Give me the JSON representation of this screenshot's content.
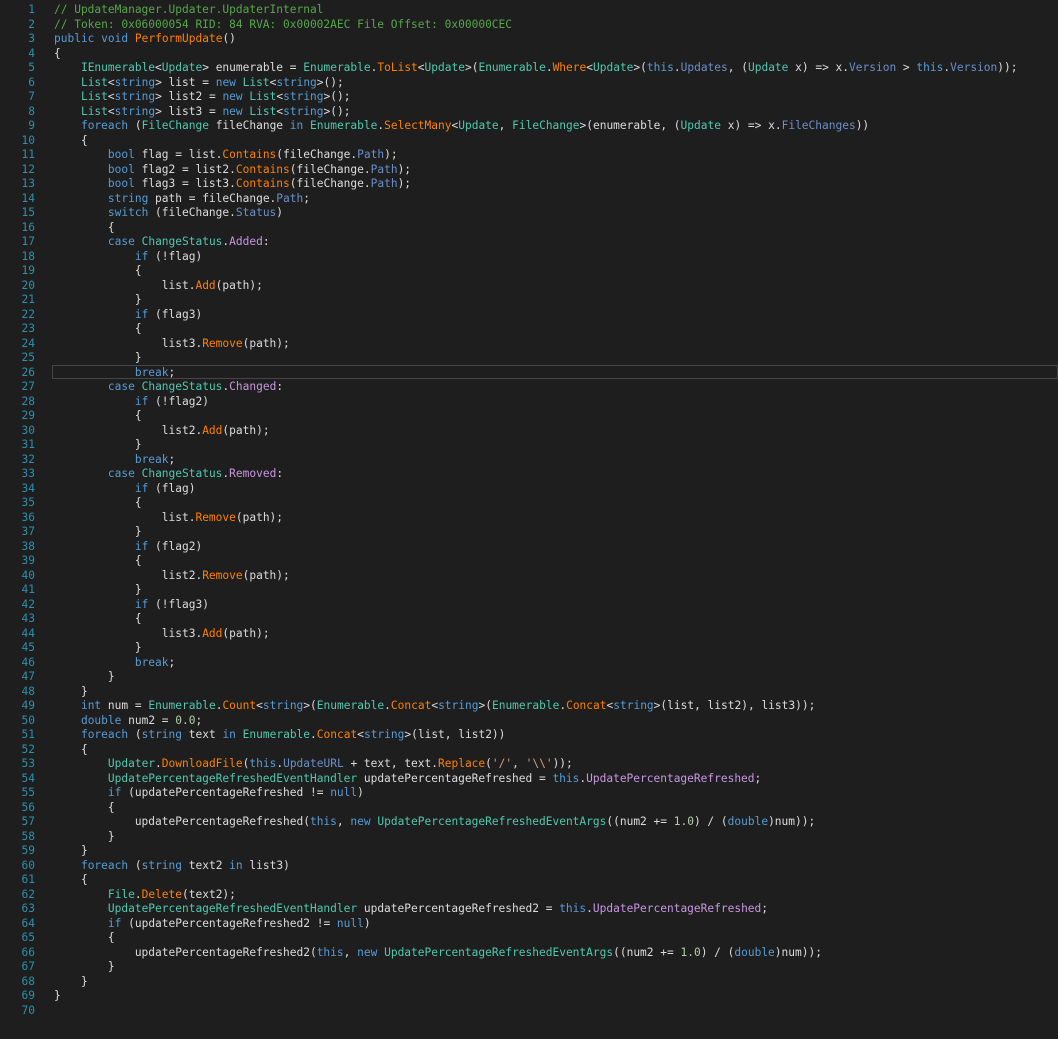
{
  "editor": {
    "lines": [
      [
        [
          "c",
          "// UpdateManager.Updater.UpdaterInternal"
        ]
      ],
      [
        [
          "c",
          "// Token: 0x06000054 RID: 84 RVA: 0x00002AEC File Offset: 0x00000CEC"
        ]
      ],
      [
        [
          "k",
          "public"
        ],
        [
          "p",
          " "
        ],
        [
          "k",
          "void"
        ],
        [
          "p",
          " "
        ],
        [
          "m",
          "PerformUpdate"
        ],
        [
          "p",
          "()"
        ]
      ],
      [
        [
          "p",
          "{"
        ]
      ],
      [
        [
          "p",
          "    "
        ],
        [
          "ty",
          "IEnumerable"
        ],
        [
          "p",
          "<"
        ],
        [
          "ty",
          "Update"
        ],
        [
          "p",
          "> enumerable = "
        ],
        [
          "ty",
          "Enumerable"
        ],
        [
          "p",
          "."
        ],
        [
          "m",
          "ToList"
        ],
        [
          "p",
          "<"
        ],
        [
          "ty",
          "Update"
        ],
        [
          "p",
          ">("
        ],
        [
          "ty",
          "Enumerable"
        ],
        [
          "p",
          "."
        ],
        [
          "m",
          "Where"
        ],
        [
          "p",
          "<"
        ],
        [
          "ty",
          "Update"
        ],
        [
          "p",
          ">("
        ],
        [
          "k",
          "this"
        ],
        [
          "p",
          "."
        ],
        [
          "pr",
          "Updates"
        ],
        [
          "p",
          ", ("
        ],
        [
          "ty",
          "Update"
        ],
        [
          "p",
          " x) => x."
        ],
        [
          "pr",
          "Version"
        ],
        [
          "p",
          " > "
        ],
        [
          "k",
          "this"
        ],
        [
          "p",
          "."
        ],
        [
          "pr",
          "Version"
        ],
        [
          "p",
          "));"
        ]
      ],
      [
        [
          "p",
          "    "
        ],
        [
          "ty",
          "List"
        ],
        [
          "p",
          "<"
        ],
        [
          "k",
          "string"
        ],
        [
          "p",
          "> list = "
        ],
        [
          "k",
          "new"
        ],
        [
          "p",
          " "
        ],
        [
          "ty",
          "List"
        ],
        [
          "p",
          "<"
        ],
        [
          "k",
          "string"
        ],
        [
          "p",
          ">();"
        ]
      ],
      [
        [
          "p",
          "    "
        ],
        [
          "ty",
          "List"
        ],
        [
          "p",
          "<"
        ],
        [
          "k",
          "string"
        ],
        [
          "p",
          "> list2 = "
        ],
        [
          "k",
          "new"
        ],
        [
          "p",
          " "
        ],
        [
          "ty",
          "List"
        ],
        [
          "p",
          "<"
        ],
        [
          "k",
          "string"
        ],
        [
          "p",
          ">();"
        ]
      ],
      [
        [
          "p",
          "    "
        ],
        [
          "ty",
          "List"
        ],
        [
          "p",
          "<"
        ],
        [
          "k",
          "string"
        ],
        [
          "p",
          "> list3 = "
        ],
        [
          "k",
          "new"
        ],
        [
          "p",
          " "
        ],
        [
          "ty",
          "List"
        ],
        [
          "p",
          "<"
        ],
        [
          "k",
          "string"
        ],
        [
          "p",
          ">();"
        ]
      ],
      [
        [
          "p",
          "    "
        ],
        [
          "k",
          "foreach"
        ],
        [
          "p",
          " ("
        ],
        [
          "ty",
          "FileChange"
        ],
        [
          "p",
          " fileChange "
        ],
        [
          "k",
          "in"
        ],
        [
          "p",
          " "
        ],
        [
          "ty",
          "Enumerable"
        ],
        [
          "p",
          "."
        ],
        [
          "m",
          "SelectMany"
        ],
        [
          "p",
          "<"
        ],
        [
          "ty",
          "Update"
        ],
        [
          "p",
          ", "
        ],
        [
          "ty",
          "FileChange"
        ],
        [
          "p",
          ">(enumerable, ("
        ],
        [
          "ty",
          "Update"
        ],
        [
          "p",
          " x) => x."
        ],
        [
          "pr",
          "FileChanges"
        ],
        [
          "p",
          "))"
        ]
      ],
      [
        [
          "p",
          "    {"
        ]
      ],
      [
        [
          "p",
          "        "
        ],
        [
          "k",
          "bool"
        ],
        [
          "p",
          " flag = list."
        ],
        [
          "m",
          "Contains"
        ],
        [
          "p",
          "(fileChange."
        ],
        [
          "pr",
          "Path"
        ],
        [
          "p",
          ");"
        ]
      ],
      [
        [
          "p",
          "        "
        ],
        [
          "k",
          "bool"
        ],
        [
          "p",
          " flag2 = list2."
        ],
        [
          "m",
          "Contains"
        ],
        [
          "p",
          "(fileChange."
        ],
        [
          "pr",
          "Path"
        ],
        [
          "p",
          ");"
        ]
      ],
      [
        [
          "p",
          "        "
        ],
        [
          "k",
          "bool"
        ],
        [
          "p",
          " flag3 = list3."
        ],
        [
          "m",
          "Contains"
        ],
        [
          "p",
          "(fileChange."
        ],
        [
          "pr",
          "Path"
        ],
        [
          "p",
          ");"
        ]
      ],
      [
        [
          "p",
          "        "
        ],
        [
          "k",
          "string"
        ],
        [
          "p",
          " path = fileChange."
        ],
        [
          "pr",
          "Path"
        ],
        [
          "p",
          ";"
        ]
      ],
      [
        [
          "p",
          "        "
        ],
        [
          "k",
          "switch"
        ],
        [
          "p",
          " (fileChange."
        ],
        [
          "pr",
          "Status"
        ],
        [
          "p",
          ")"
        ]
      ],
      [
        [
          "p",
          "        {"
        ]
      ],
      [
        [
          "p",
          "        "
        ],
        [
          "k",
          "case"
        ],
        [
          "p",
          " "
        ],
        [
          "ty",
          "ChangeStatus"
        ],
        [
          "p",
          "."
        ],
        [
          "e",
          "Added"
        ],
        [
          "p",
          ":"
        ]
      ],
      [
        [
          "p",
          "            "
        ],
        [
          "k",
          "if"
        ],
        [
          "p",
          " (!flag)"
        ]
      ],
      [
        [
          "p",
          "            {"
        ]
      ],
      [
        [
          "p",
          "                list."
        ],
        [
          "m",
          "Add"
        ],
        [
          "p",
          "(path);"
        ]
      ],
      [
        [
          "p",
          "            }"
        ]
      ],
      [
        [
          "p",
          "            "
        ],
        [
          "k",
          "if"
        ],
        [
          "p",
          " (flag3)"
        ]
      ],
      [
        [
          "p",
          "            {"
        ]
      ],
      [
        [
          "p",
          "                list3."
        ],
        [
          "m",
          "Remove"
        ],
        [
          "p",
          "(path);"
        ]
      ],
      [
        [
          "p",
          "            }"
        ]
      ],
      [
        [
          "p",
          "            "
        ],
        [
          "k",
          "break"
        ],
        [
          "p",
          ";"
        ]
      ],
      [
        [
          "p",
          "        "
        ],
        [
          "k",
          "case"
        ],
        [
          "p",
          " "
        ],
        [
          "ty",
          "ChangeStatus"
        ],
        [
          "p",
          "."
        ],
        [
          "e",
          "Changed"
        ],
        [
          "p",
          ":"
        ]
      ],
      [
        [
          "p",
          "            "
        ],
        [
          "k",
          "if"
        ],
        [
          "p",
          " (!flag2)"
        ]
      ],
      [
        [
          "p",
          "            {"
        ]
      ],
      [
        [
          "p",
          "                list2."
        ],
        [
          "m",
          "Add"
        ],
        [
          "p",
          "(path);"
        ]
      ],
      [
        [
          "p",
          "            }"
        ]
      ],
      [
        [
          "p",
          "            "
        ],
        [
          "k",
          "break"
        ],
        [
          "p",
          ";"
        ]
      ],
      [
        [
          "p",
          "        "
        ],
        [
          "k",
          "case"
        ],
        [
          "p",
          " "
        ],
        [
          "ty",
          "ChangeStatus"
        ],
        [
          "p",
          "."
        ],
        [
          "e",
          "Removed"
        ],
        [
          "p",
          ":"
        ]
      ],
      [
        [
          "p",
          "            "
        ],
        [
          "k",
          "if"
        ],
        [
          "p",
          " (flag)"
        ]
      ],
      [
        [
          "p",
          "            {"
        ]
      ],
      [
        [
          "p",
          "                list."
        ],
        [
          "m",
          "Remove"
        ],
        [
          "p",
          "(path);"
        ]
      ],
      [
        [
          "p",
          "            }"
        ]
      ],
      [
        [
          "p",
          "            "
        ],
        [
          "k",
          "if"
        ],
        [
          "p",
          " (flag2)"
        ]
      ],
      [
        [
          "p",
          "            {"
        ]
      ],
      [
        [
          "p",
          "                list2."
        ],
        [
          "m",
          "Remove"
        ],
        [
          "p",
          "(path);"
        ]
      ],
      [
        [
          "p",
          "            }"
        ]
      ],
      [
        [
          "p",
          "            "
        ],
        [
          "k",
          "if"
        ],
        [
          "p",
          " (!flag3)"
        ]
      ],
      [
        [
          "p",
          "            {"
        ]
      ],
      [
        [
          "p",
          "                list3."
        ],
        [
          "m",
          "Add"
        ],
        [
          "p",
          "(path);"
        ]
      ],
      [
        [
          "p",
          "            }"
        ]
      ],
      [
        [
          "p",
          "            "
        ],
        [
          "k",
          "break"
        ],
        [
          "p",
          ";"
        ]
      ],
      [
        [
          "p",
          "        }"
        ]
      ],
      [
        [
          "p",
          "    }"
        ]
      ],
      [
        [
          "p",
          "    "
        ],
        [
          "k",
          "int"
        ],
        [
          "p",
          " num = "
        ],
        [
          "ty",
          "Enumerable"
        ],
        [
          "p",
          "."
        ],
        [
          "m",
          "Count"
        ],
        [
          "p",
          "<"
        ],
        [
          "k",
          "string"
        ],
        [
          "p",
          ">("
        ],
        [
          "ty",
          "Enumerable"
        ],
        [
          "p",
          "."
        ],
        [
          "m",
          "Concat"
        ],
        [
          "p",
          "<"
        ],
        [
          "k",
          "string"
        ],
        [
          "p",
          ">("
        ],
        [
          "ty",
          "Enumerable"
        ],
        [
          "p",
          "."
        ],
        [
          "m",
          "Concat"
        ],
        [
          "p",
          "<"
        ],
        [
          "k",
          "string"
        ],
        [
          "p",
          ">(list, list2), list3));"
        ]
      ],
      [
        [
          "p",
          "    "
        ],
        [
          "k",
          "double"
        ],
        [
          "p",
          " num2 = "
        ],
        [
          "n",
          "0.0"
        ],
        [
          "p",
          ";"
        ]
      ],
      [
        [
          "p",
          "    "
        ],
        [
          "k",
          "foreach"
        ],
        [
          "p",
          " ("
        ],
        [
          "k",
          "string"
        ],
        [
          "p",
          " text "
        ],
        [
          "k",
          "in"
        ],
        [
          "p",
          " "
        ],
        [
          "ty",
          "Enumerable"
        ],
        [
          "p",
          "."
        ],
        [
          "m",
          "Concat"
        ],
        [
          "p",
          "<"
        ],
        [
          "k",
          "string"
        ],
        [
          "p",
          ">(list, list2))"
        ]
      ],
      [
        [
          "p",
          "    {"
        ]
      ],
      [
        [
          "p",
          "        "
        ],
        [
          "ty",
          "Updater"
        ],
        [
          "p",
          "."
        ],
        [
          "m",
          "DownloadFile"
        ],
        [
          "p",
          "("
        ],
        [
          "k",
          "this"
        ],
        [
          "p",
          "."
        ],
        [
          "pr",
          "UpdateURL"
        ],
        [
          "p",
          " + text, text."
        ],
        [
          "m",
          "Replace"
        ],
        [
          "p",
          "("
        ],
        [
          "s",
          "'/'"
        ],
        [
          "p",
          ", "
        ],
        [
          "s",
          "'\\\\'"
        ],
        [
          "p",
          "));"
        ]
      ],
      [
        [
          "p",
          "        "
        ],
        [
          "ty",
          "UpdatePercentageRefreshedEventHandler"
        ],
        [
          "p",
          " updatePercentageRefreshed = "
        ],
        [
          "k",
          "this"
        ],
        [
          "p",
          "."
        ],
        [
          "pp",
          "UpdatePercentageRefreshed"
        ],
        [
          "p",
          ";"
        ]
      ],
      [
        [
          "p",
          "        "
        ],
        [
          "k",
          "if"
        ],
        [
          "p",
          " (updatePercentageRefreshed != "
        ],
        [
          "k",
          "null"
        ],
        [
          "p",
          ")"
        ]
      ],
      [
        [
          "p",
          "        {"
        ]
      ],
      [
        [
          "p",
          "            updatePercentageRefreshed("
        ],
        [
          "k",
          "this"
        ],
        [
          "p",
          ", "
        ],
        [
          "k",
          "new"
        ],
        [
          "p",
          " "
        ],
        [
          "ty",
          "UpdatePercentageRefreshedEventArgs"
        ],
        [
          "p",
          "((num2 += "
        ],
        [
          "n",
          "1.0"
        ],
        [
          "p",
          ") / ("
        ],
        [
          "k",
          "double"
        ],
        [
          "p",
          ")num));"
        ]
      ],
      [
        [
          "p",
          "        }"
        ]
      ],
      [
        [
          "p",
          "    }"
        ]
      ],
      [
        [
          "p",
          "    "
        ],
        [
          "k",
          "foreach"
        ],
        [
          "p",
          " ("
        ],
        [
          "k",
          "string"
        ],
        [
          "p",
          " text2 "
        ],
        [
          "k",
          "in"
        ],
        [
          "p",
          " list3)"
        ]
      ],
      [
        [
          "p",
          "    {"
        ]
      ],
      [
        [
          "p",
          "        "
        ],
        [
          "ty",
          "File"
        ],
        [
          "p",
          "."
        ],
        [
          "m",
          "Delete"
        ],
        [
          "p",
          "(text2);"
        ]
      ],
      [
        [
          "p",
          "        "
        ],
        [
          "ty",
          "UpdatePercentageRefreshedEventHandler"
        ],
        [
          "p",
          " updatePercentageRefreshed2 = "
        ],
        [
          "k",
          "this"
        ],
        [
          "p",
          "."
        ],
        [
          "pp",
          "UpdatePercentageRefreshed"
        ],
        [
          "p",
          ";"
        ]
      ],
      [
        [
          "p",
          "        "
        ],
        [
          "k",
          "if"
        ],
        [
          "p",
          " (updatePercentageRefreshed2 != "
        ],
        [
          "k",
          "null"
        ],
        [
          "p",
          ")"
        ]
      ],
      [
        [
          "p",
          "        {"
        ]
      ],
      [
        [
          "p",
          "            updatePercentageRefreshed2("
        ],
        [
          "k",
          "this"
        ],
        [
          "p",
          ", "
        ],
        [
          "k",
          "new"
        ],
        [
          "p",
          " "
        ],
        [
          "ty",
          "UpdatePercentageRefreshedEventArgs"
        ],
        [
          "p",
          "((num2 += "
        ],
        [
          "n",
          "1.0"
        ],
        [
          "p",
          ") / ("
        ],
        [
          "k",
          "double"
        ],
        [
          "p",
          ")num));"
        ]
      ],
      [
        [
          "p",
          "        }"
        ]
      ],
      [
        [
          "p",
          "    }"
        ]
      ],
      [
        [
          "p",
          "}"
        ]
      ],
      [
        [
          "p",
          ""
        ]
      ]
    ],
    "current_line": 26,
    "colors": {
      "background": "#1e1e1e",
      "line_number": "#2b91af",
      "plain": "#dcdcdc",
      "keyword": "#569cd6",
      "type": "#4ec9b0",
      "method": "#ff8000",
      "property": "#6a8fca",
      "event": "#c896e0",
      "comment": "#57a64a",
      "string": "#d69d85",
      "number": "#b5cea8"
    }
  }
}
